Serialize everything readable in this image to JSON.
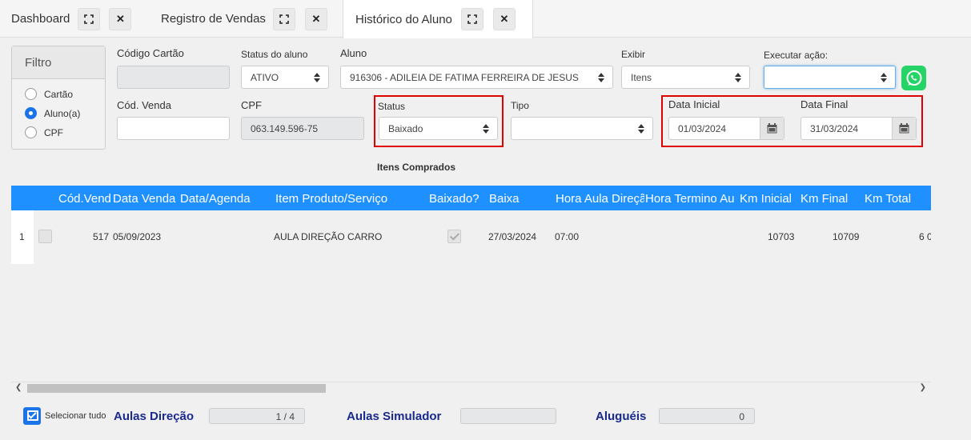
{
  "tabs": [
    {
      "label": "Dashboard"
    },
    {
      "label": "Registro de Vendas"
    },
    {
      "label": "Histórico do Aluno"
    }
  ],
  "filtro": {
    "title": "Filtro",
    "options": [
      "Cartão",
      "Aluno(a)",
      "CPF"
    ],
    "selected": "Aluno(a)"
  },
  "form": {
    "codigo_cartao_label": "Código Cartão",
    "codigo_cartao_value": "",
    "status_aluno_label": "Status do aluno",
    "status_aluno_value": "ATIVO",
    "aluno_label": "Aluno",
    "aluno_value": "916306 - ADILEIA DE FATIMA FERREIRA DE JESUS",
    "exibir_label": "Exibir",
    "exibir_value": "Itens",
    "executar_label": "Executar ação:",
    "executar_value": "",
    "cod_venda_label": "Cód. Venda",
    "cod_venda_value": "",
    "cpf_label": "CPF",
    "cpf_value": "063.149.596-75",
    "status_label": "Status",
    "status_value": "Baixado",
    "tipo_label": "Tipo",
    "tipo_value": "",
    "data_inicial_label": "Data Inicial",
    "data_inicial_value": "01/03/2024",
    "data_final_label": "Data Final",
    "data_final_value": "31/03/2024"
  },
  "section_title": "Itens Comprados",
  "grid": {
    "columns": [
      "Cód.Venda",
      "Data Venda",
      "Data/Agenda",
      "Item Produto/Serviço",
      "Baixado?",
      "Baixa",
      "Hora Aula Direção",
      "Hora Termino Aula",
      "Km Inicial",
      "Km Final",
      "Km Total"
    ],
    "rows": [
      {
        "index": "1",
        "cod_venda": "517",
        "data_venda": "05/09/2023",
        "data_agenda": "",
        "item": "AULA DIREÇÃO CARRO",
        "baixado": true,
        "baixa": "27/03/2024",
        "hora_aula": "07:00",
        "hora_termino": "",
        "km_inicial": "10703",
        "km_final": "10709",
        "km_total": "6 0"
      }
    ]
  },
  "footer": {
    "select_all_label": "Selecionar tudo",
    "aulas_direcao_label": "Aulas Direção",
    "aulas_direcao_value": "1 / 4",
    "aulas_simulador_label": "Aulas Simulador",
    "aulas_simulador_value": "",
    "alugueis_label": "Aluguéis",
    "alugueis_value": "0"
  },
  "colors": {
    "grid_header": "#1e90ff",
    "highlight": "#e00000",
    "label_blue": "#1a2a8c",
    "whatsapp": "#25d366"
  }
}
